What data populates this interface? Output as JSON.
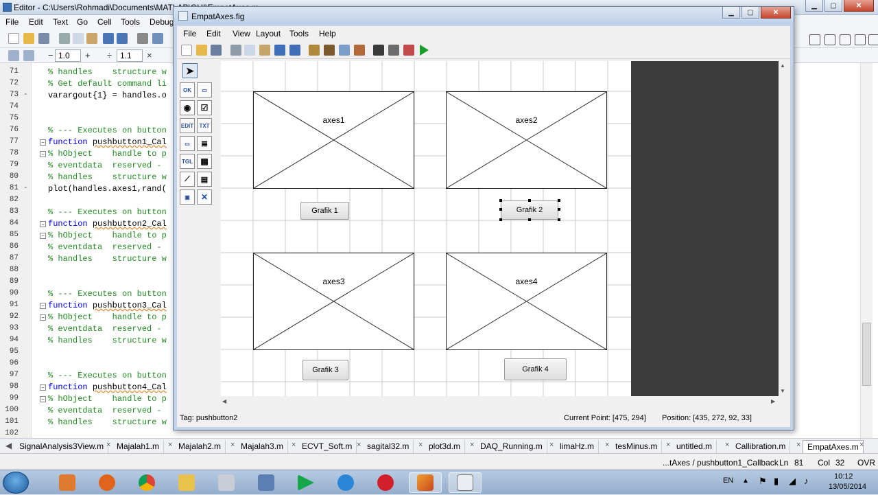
{
  "editor": {
    "title": "Editor - C:\\Users\\Rohmadi\\Documents\\MATLAB\\GUI\\EmpatAxes.m",
    "menu": [
      "File",
      "Edit",
      "Text",
      "Go",
      "Cell",
      "Tools",
      "Debug"
    ],
    "toolbar2": {
      "decrement": "−",
      "value1": "1.0",
      "increment": "+",
      "divide": "÷",
      "value2": "1.1",
      "times": "×"
    },
    "code_lines": [
      {
        "n": "71",
        "text": "% handles    structure w",
        "cls": "cm",
        "dash": false
      },
      {
        "n": "72",
        "text": "% Get default command li",
        "cls": "cm",
        "dash": false
      },
      {
        "n": "73",
        "text": "varargout{1} = handles.o",
        "cls": "",
        "dash": true
      },
      {
        "n": "74",
        "text": "",
        "cls": "",
        "dash": false
      },
      {
        "n": "75",
        "text": "",
        "cls": "",
        "dash": false
      },
      {
        "n": "76",
        "text": "% --- Executes on button",
        "cls": "cm",
        "dash": false
      },
      {
        "n": "77",
        "text": "function pushbutton1_Cal",
        "cls": "fn",
        "dash": false
      },
      {
        "n": "78",
        "text": "% hObject    handle to p",
        "cls": "cm",
        "dash": false
      },
      {
        "n": "79",
        "text": "% eventdata  reserved - ",
        "cls": "cm",
        "dash": false
      },
      {
        "n": "80",
        "text": "% handles    structure w",
        "cls": "cm",
        "dash": false
      },
      {
        "n": "81",
        "text": "plot(handles.axes1,rand(",
        "cls": "",
        "dash": true
      },
      {
        "n": "82",
        "text": "",
        "cls": "",
        "dash": false
      },
      {
        "n": "83",
        "text": "% --- Executes on button",
        "cls": "cm",
        "dash": false
      },
      {
        "n": "84",
        "text": "function pushbutton2_Cal",
        "cls": "fn",
        "dash": false
      },
      {
        "n": "85",
        "text": "% hObject    handle to p",
        "cls": "cm",
        "dash": false
      },
      {
        "n": "86",
        "text": "% eventdata  reserved - ",
        "cls": "cm",
        "dash": false
      },
      {
        "n": "87",
        "text": "% handles    structure w",
        "cls": "cm",
        "dash": false
      },
      {
        "n": "88",
        "text": "",
        "cls": "",
        "dash": false
      },
      {
        "n": "89",
        "text": "",
        "cls": "",
        "dash": false
      },
      {
        "n": "90",
        "text": "% --- Executes on button",
        "cls": "cm",
        "dash": false
      },
      {
        "n": "91",
        "text": "function pushbutton3_Cal",
        "cls": "fn",
        "dash": false
      },
      {
        "n": "92",
        "text": "% hObject    handle to p",
        "cls": "cm",
        "dash": false
      },
      {
        "n": "93",
        "text": "% eventdata  reserved - ",
        "cls": "cm",
        "dash": false
      },
      {
        "n": "94",
        "text": "% handles    structure w",
        "cls": "cm",
        "dash": false
      },
      {
        "n": "95",
        "text": "",
        "cls": "",
        "dash": false
      },
      {
        "n": "96",
        "text": "",
        "cls": "",
        "dash": false
      },
      {
        "n": "97",
        "text": "% --- Executes on button",
        "cls": "cm",
        "dash": false
      },
      {
        "n": "98",
        "text": "function pushbutton4_Cal",
        "cls": "fn",
        "dash": false
      },
      {
        "n": "99",
        "text": "% hObject    handle to p",
        "cls": "cm",
        "dash": false
      },
      {
        "n": "100",
        "text": "% eventdata  reserved - ",
        "cls": "cm",
        "dash": false
      },
      {
        "n": "101",
        "text": "% handles    structure w",
        "cls": "cm",
        "dash": false
      },
      {
        "n": "102",
        "text": "",
        "cls": "",
        "dash": false
      }
    ],
    "file_tabs": [
      "SignalAnalysis3View.m",
      "Majalah1.m",
      "Majalah2.m",
      "Majalah3.m",
      "ECVT_Soft.m",
      "sagital32.m",
      "plot3d.m",
      "DAQ_Running.m",
      "limaHz.m",
      "tesMinus.m",
      "untitled.m",
      "Callibration.m",
      "EmpatAxes.m"
    ],
    "active_tab": "EmpatAxes.m",
    "status": {
      "function": "...tAxes / pushbutton1_Callback",
      "ln_label": "Ln",
      "ln": "81",
      "col_label": "Col",
      "col": "32",
      "mode": "OVR"
    }
  },
  "guide": {
    "title": "EmpatAxes.fig",
    "menu": [
      "File",
      "Edit",
      "View",
      "Layout",
      "Tools",
      "Help"
    ],
    "axes": [
      "axes1",
      "axes2",
      "axes3",
      "axes4"
    ],
    "buttons": [
      "Grafik 1",
      "Grafik 2",
      "Grafik 3",
      "Grafik 4"
    ],
    "selected_button": "Grafik 2",
    "status": {
      "tag": "Tag: pushbutton2",
      "current_point": "Current Point:  [475, 294]",
      "position": "Position: [435, 272, 92, 33]"
    }
  },
  "taskbar": {
    "language": "EN",
    "time": "10:12",
    "date": "13/05/2014"
  },
  "colors": {
    "comment": "#228b22",
    "keyword": "#0000ff",
    "dark_area": "#3c3c3c"
  }
}
